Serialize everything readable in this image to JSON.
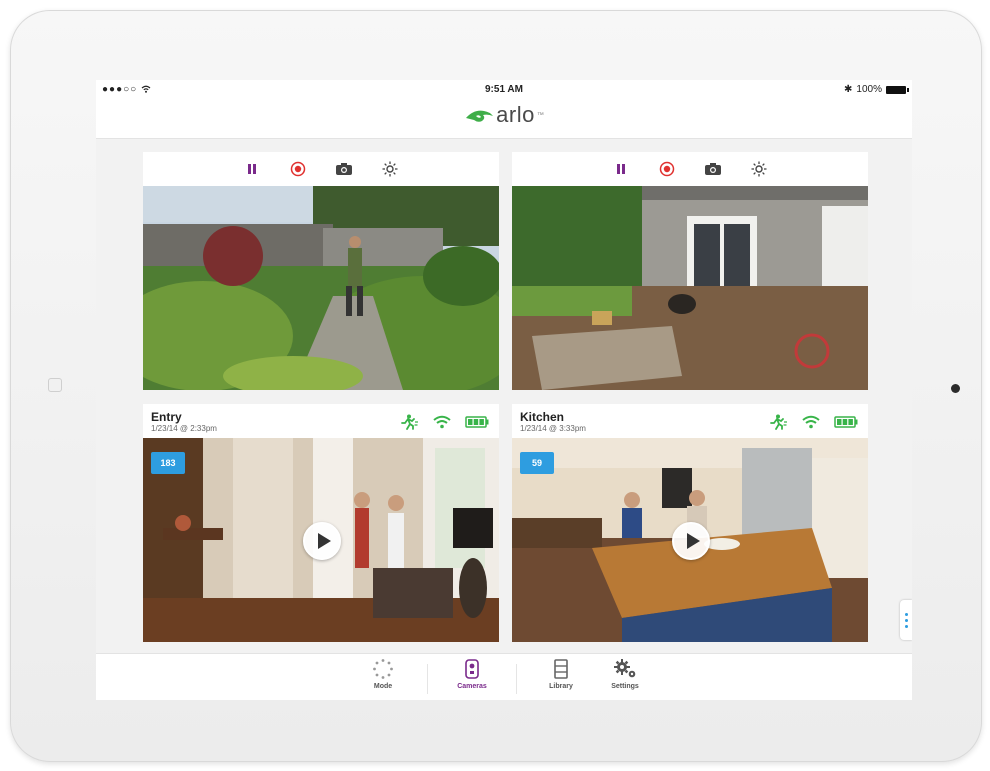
{
  "status_bar": {
    "signal": "●●●○○",
    "time": "9:51 AM",
    "bluetooth": "✱",
    "battery": "100%"
  },
  "header": {
    "logo_text": "arlo",
    "logo_mark": "™"
  },
  "colors": {
    "brand_green": "#3fae49",
    "accent_purple": "#7a2a8b",
    "record_red": "#e0312f",
    "status_green": "#38b449",
    "badge_blue": "#2e9de0"
  },
  "live_cameras": [
    {
      "controls": [
        "pause-icon",
        "record-icon",
        "snapshot-icon",
        "brightness-icon"
      ]
    },
    {
      "controls": [
        "pause-icon",
        "record-icon",
        "snapshot-icon",
        "brightness-icon"
      ]
    }
  ],
  "recorded_cameras": [
    {
      "name": "Entry",
      "timestamp": "1/23/14 @ 2:33pm",
      "clip_count": "183",
      "status_icons": [
        "motion-icon",
        "wifi-icon",
        "battery-icon"
      ]
    },
    {
      "name": "Kitchen",
      "timestamp": "1/23/14 @ 3:33pm",
      "clip_count": "59",
      "status_icons": [
        "motion-icon",
        "wifi-icon",
        "battery-icon"
      ]
    }
  ],
  "tabbar": {
    "tabs": [
      {
        "label": "Mode",
        "icon": "mode-icon",
        "active": false
      },
      {
        "label": "Cameras",
        "icon": "camera-icon",
        "active": true
      },
      {
        "label": "Library",
        "icon": "library-icon",
        "active": false
      },
      {
        "label": "Settings",
        "icon": "gear-icon",
        "active": false
      }
    ]
  }
}
